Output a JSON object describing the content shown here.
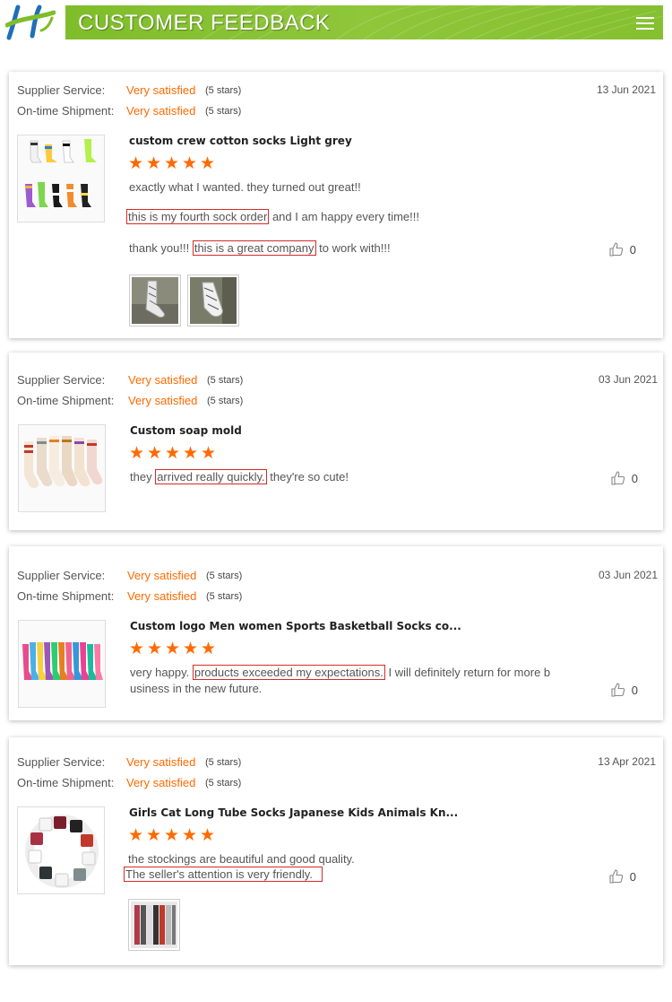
{
  "header": {
    "title": "CUSTOMER FEEDBACK",
    "brand_colors": {
      "blue": "#1f6fb8",
      "green": "#7fbd2a"
    }
  },
  "reviews": [
    {
      "supplier_label": "Supplier Service:",
      "shipment_label": "On-time Shipment:",
      "supplier_value": "Very satisfied",
      "supplier_stars": "(5 stars)",
      "shipment_value": "Very satisfied",
      "shipment_stars": "(5 stars)",
      "date": "13 Jun 2021",
      "product_title": "custom crew cotton socks Light grey",
      "rating": 5,
      "text1": "exactly what I wanted. they turned out great!!",
      "text2_hl": "this is my fourth sock order",
      "text2_rest": "and I am happy every time!!!",
      "text3_pre": "thank you!!!",
      "text3_hl": "this is a great company",
      "text3_rest": "to work with!!!",
      "likes": "0",
      "photos": 2
    },
    {
      "supplier_label": "Supplier Service:",
      "shipment_label": "On-time Shipment:",
      "supplier_value": "Very satisfied",
      "supplier_stars": "(5 stars)",
      "shipment_value": "Very satisfied",
      "shipment_stars": "(5 stars)",
      "date": "03 Jun 2021",
      "product_title": "Custom soap mold",
      "rating": 5,
      "text1_pre": "they",
      "text1_hl": "arrived really quickly.",
      "text1_rest": "they're so cute!",
      "likes": "0"
    },
    {
      "supplier_label": "Supplier Service:",
      "shipment_label": "On-time Shipment:",
      "supplier_value": "Very satisfied",
      "supplier_stars": "(5 stars)",
      "shipment_value": "Very satisfied",
      "shipment_stars": "(5 stars)",
      "date": "03 Jun 2021",
      "product_title": "Custom logo Men women Sports Basketball Socks co...",
      "rating": 5,
      "text1_pre": "very happy.",
      "text1_hl": "products exceeded my expectations.",
      "text1_rest": "I will definitely return for more b",
      "text2": "usiness in the new future.",
      "likes": "0"
    },
    {
      "supplier_label": "Supplier Service:",
      "shipment_label": "On-time Shipment:",
      "supplier_value": "Very satisfied",
      "supplier_stars": "(5 stars)",
      "shipment_value": "Very satisfied",
      "shipment_stars": "(5 stars)",
      "date": "13 Apr 2021",
      "product_title": "Girls Cat Long Tube Socks Japanese Kids Animals Kn...",
      "rating": 5,
      "text1": "the stockings are beautiful and good quality.",
      "text2_hl": "The seller's attention is very friendly.",
      "likes": "0",
      "photos": 1
    }
  ]
}
